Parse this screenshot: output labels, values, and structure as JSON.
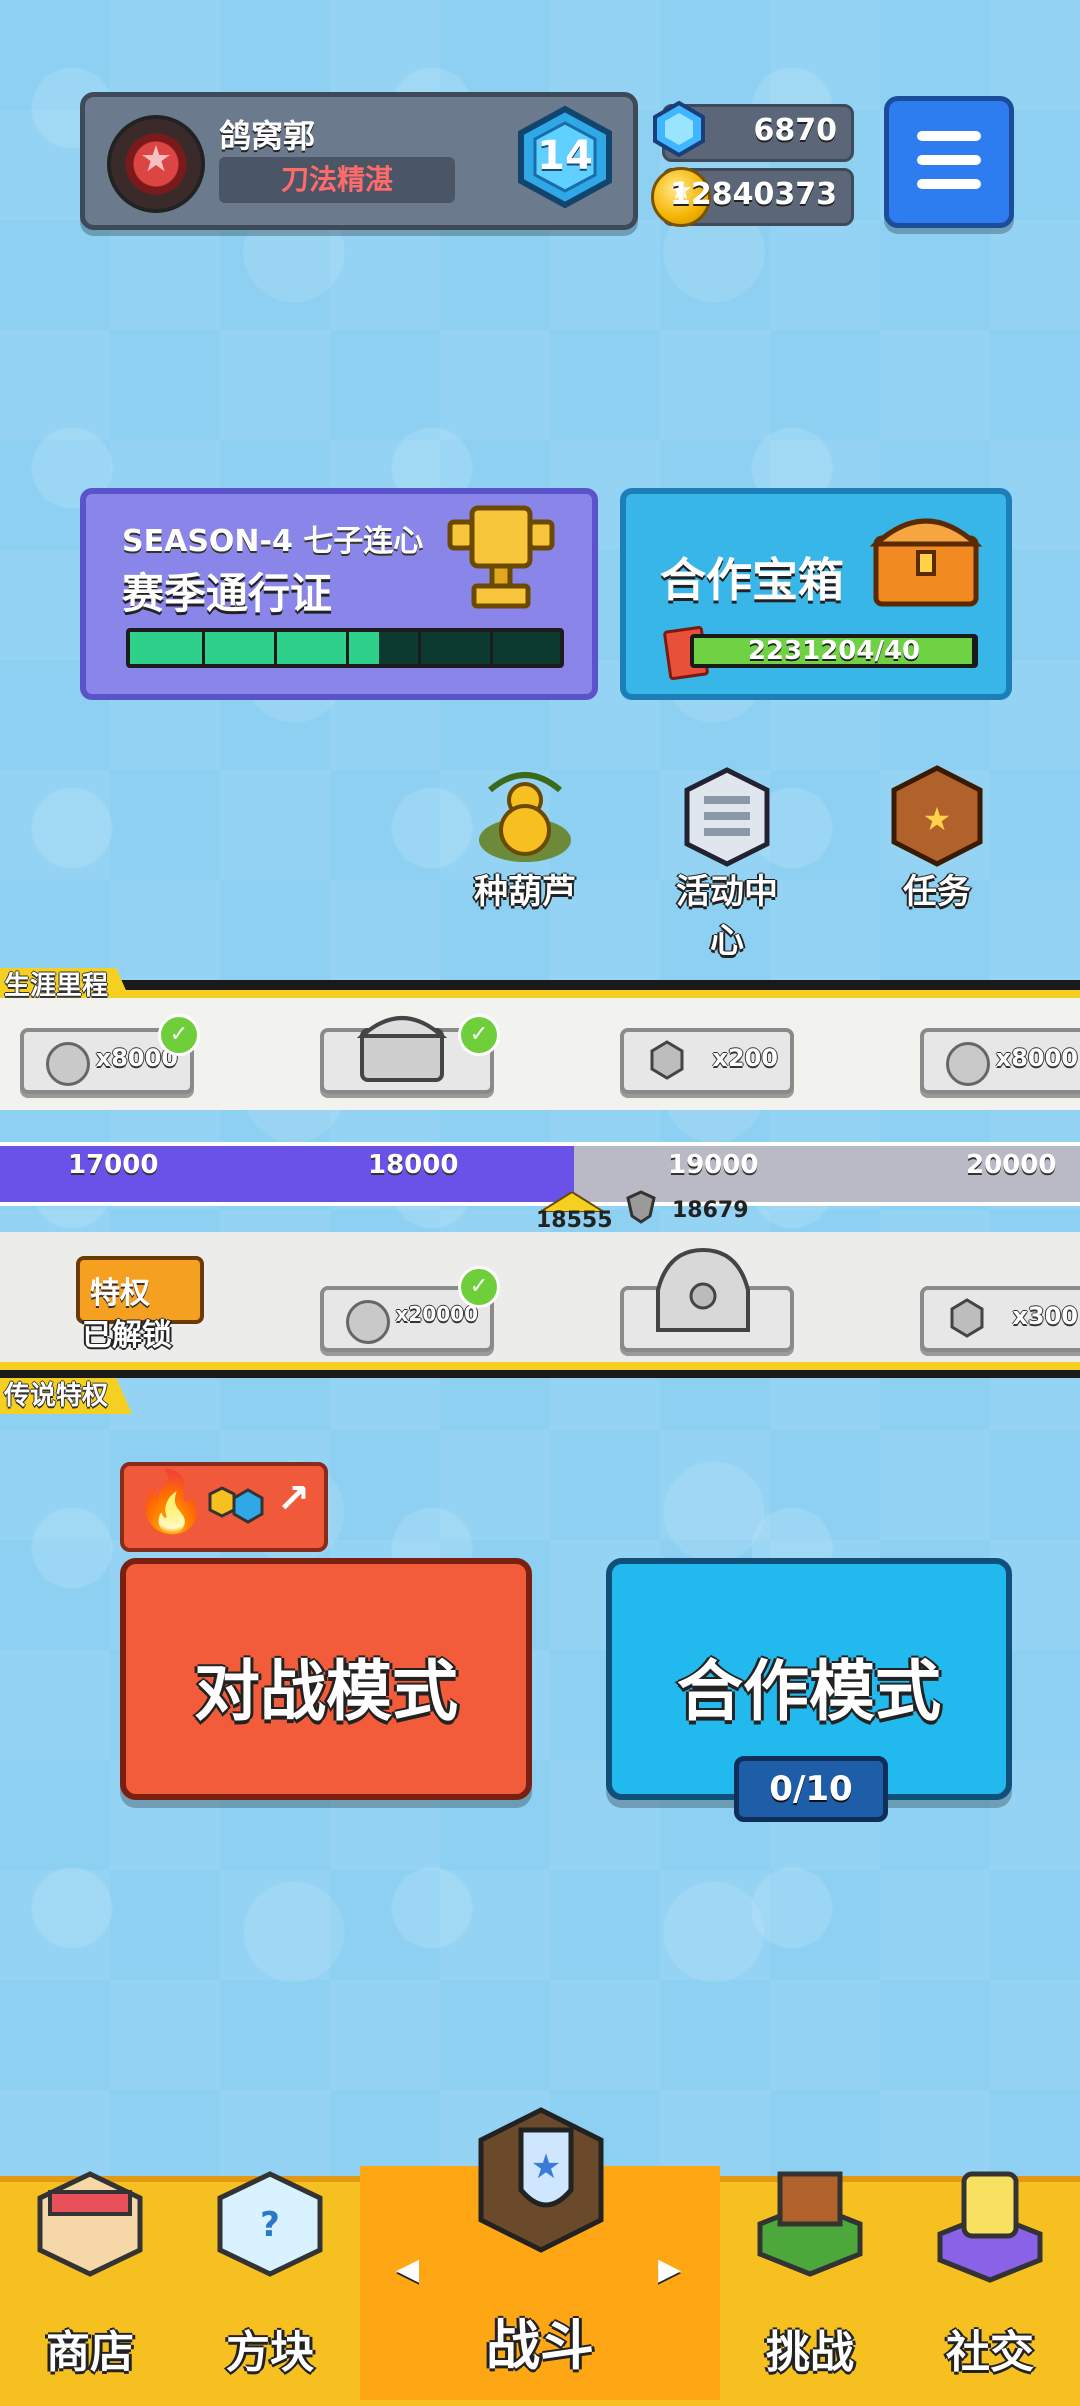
{
  "player": {
    "name": "鸽窝郭",
    "title": "刀法精湛",
    "rank_level": "14"
  },
  "currency": {
    "gems": "6870",
    "coins": "12840373"
  },
  "season_pass": {
    "subtitle": "SEASON-4 七子连心",
    "title": "赛季通行证",
    "progress": 0.58
  },
  "coop_chest": {
    "title": "合作宝箱",
    "progress_text": "2231204/40"
  },
  "quick_menu": [
    {
      "label": "种葫芦",
      "icon": "gourd-icon"
    },
    {
      "label": "活动中心",
      "icon": "activity-center-icon"
    },
    {
      "label": "任务",
      "icon": "quest-book-icon"
    }
  ],
  "career": {
    "tag": "生涯里程",
    "ticks": [
      "17000",
      "18000",
      "19000",
      "20000"
    ],
    "current_trophies": "18555",
    "max_trophies": "18679",
    "top_rewards": [
      {
        "label": "x8000",
        "type": "coin",
        "claimed": true
      },
      {
        "label": "",
        "type": "chest",
        "claimed": true
      },
      {
        "label": "x200",
        "type": "gem",
        "claimed": false
      },
      {
        "label": "x8000",
        "type": "coin",
        "claimed": false
      }
    ],
    "bottom_rewards": [
      {
        "label": "已解锁",
        "type": "privilege",
        "claimed": false
      },
      {
        "label": "x20000",
        "type": "coin",
        "claimed": true
      },
      {
        "label": "",
        "type": "dragon-chest",
        "claimed": false
      },
      {
        "label": "x300",
        "type": "gem",
        "claimed": false
      }
    ],
    "privilege_badge": "特权"
  },
  "legend": {
    "tag": "传说特权"
  },
  "modes": {
    "battle_label": "对战模式",
    "coop_label": "合作模式",
    "coop_count": "0/10"
  },
  "nav": [
    {
      "label": "商店",
      "icon": "shop-icon"
    },
    {
      "label": "方块",
      "icon": "dice-box-icon"
    },
    {
      "label": "战斗",
      "icon": "battle-shield-icon"
    },
    {
      "label": "挑战",
      "icon": "challenge-sign-icon"
    },
    {
      "label": "社交",
      "icon": "social-icon"
    }
  ],
  "colors": {
    "background": "#8dd0f2",
    "nav_bar": "#f5c020",
    "battle_button": "#f25c3a",
    "coop_button": "#22b9ef",
    "season_card": "#8a85e8",
    "track_fill": "#6a52e8"
  }
}
